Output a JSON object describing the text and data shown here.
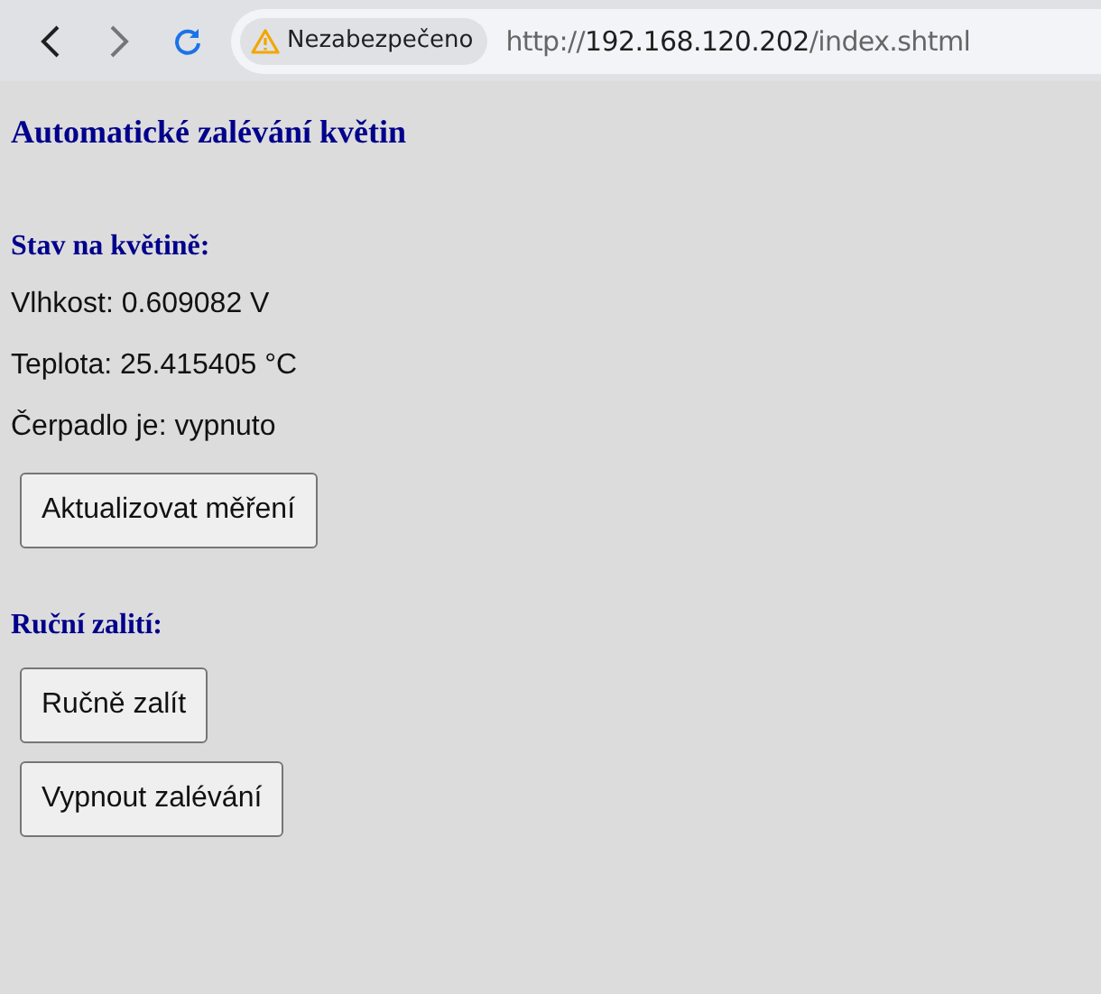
{
  "browser": {
    "security_label": "Nezabezpečeno",
    "url": {
      "scheme": "http://",
      "host": "192.168.120.202",
      "path": "/index.shtml"
    }
  },
  "page": {
    "title": "Automatické zalévání květin",
    "sections": [
      {
        "heading": "Stav na květině:",
        "lines": [
          "Vlhkost: 0.609082 V",
          "Teplota: 25.415405 °C",
          "Čerpadlo je: vypnuto"
        ],
        "buttons": [
          "Aktualizovat měření"
        ]
      },
      {
        "heading": "Ruční zalití:",
        "buttons": [
          "Ručně zalít",
          "Vypnout zalévání"
        ]
      }
    ]
  }
}
